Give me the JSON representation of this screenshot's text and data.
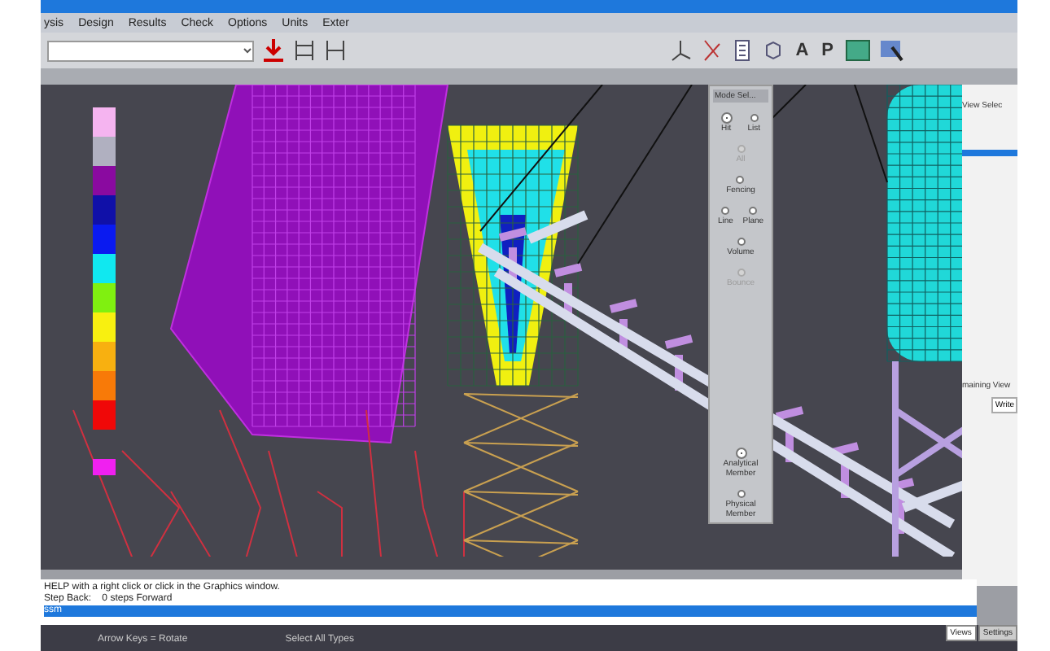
{
  "menu": [
    {
      "label": "ysis"
    },
    {
      "label": "Design"
    },
    {
      "label": "Results"
    },
    {
      "label": "Check"
    },
    {
      "label": "Options"
    },
    {
      "label": "Units"
    },
    {
      "label": "Exter"
    }
  ],
  "toolbar": {
    "text_buttons": [
      "A",
      "P"
    ]
  },
  "legend": {
    "swatches": [
      {
        "color": "#f5b4f0"
      },
      {
        "color": "#b0b0c0"
      },
      {
        "color": "#8a0aa0"
      },
      {
        "color": "#1010a8"
      },
      {
        "color": "#0a1af0"
      },
      {
        "color": "#10e8f0"
      },
      {
        "color": "#80f010"
      },
      {
        "color": "#f8f010"
      },
      {
        "color": "#f8b010"
      },
      {
        "color": "#f87a08"
      },
      {
        "color": "#f00808"
      },
      {
        "color": "#f020f0"
      }
    ]
  },
  "mode_panel": {
    "title": "Mode Sel...",
    "options": [
      {
        "kind": "pair",
        "items": [
          {
            "label": "Hit",
            "selected": true,
            "disabled": false
          },
          {
            "label": "List",
            "selected": false,
            "disabled": false
          }
        ]
      },
      {
        "kind": "single",
        "items": [
          {
            "label": "All",
            "selected": false,
            "disabled": true
          }
        ]
      },
      {
        "kind": "single",
        "items": [
          {
            "label": "Fencing",
            "selected": false,
            "disabled": false
          }
        ]
      },
      {
        "kind": "pair",
        "items": [
          {
            "label": "Line",
            "selected": false,
            "disabled": false
          },
          {
            "label": "Plane",
            "selected": false,
            "disabled": false
          }
        ]
      },
      {
        "kind": "single",
        "items": [
          {
            "label": "Volume",
            "selected": false,
            "disabled": false
          }
        ]
      },
      {
        "kind": "single",
        "items": [
          {
            "label": "Bounce",
            "selected": false,
            "disabled": true
          }
        ]
      },
      {
        "kind": "single",
        "items": [
          {
            "label": "Analytical Member",
            "selected": true,
            "disabled": false
          }
        ]
      },
      {
        "kind": "single",
        "items": [
          {
            "label": "Physical Member",
            "selected": false,
            "disabled": false
          }
        ]
      }
    ]
  },
  "side_panel": {
    "title": "View Selec",
    "section": "maining View",
    "button": "Write"
  },
  "command_area": {
    "lines": [
      "HELP with a right click or click in the Graphics window.",
      "Step Back:    0 steps Forward"
    ],
    "input": "ssm"
  },
  "bottom_tabs": [
    {
      "label": "Views",
      "selected": true
    },
    {
      "label": "Settings",
      "selected": false
    }
  ],
  "status_bar": [
    "Arrow Keys = Rotate",
    "Select All Types"
  ]
}
